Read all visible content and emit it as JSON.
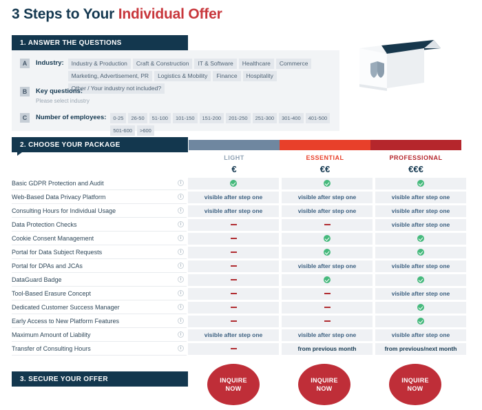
{
  "page_title": {
    "prefix": "3 Steps to Your ",
    "accent": "Individual Offer",
    "accent_color": "#c8373c",
    "base_color": "#143850"
  },
  "sections": {
    "step1_banner": "1. ANSWER THE QUESTIONS",
    "step2_banner": "2. CHOOSE YOUR PACKAGE",
    "step3_banner": "3. SECURE YOUR OFFER",
    "banner_color": "#13374e"
  },
  "step1": {
    "question_a": {
      "letter": "A",
      "label": "Industry:",
      "options": [
        "Industry & Production",
        "Craft & Construction",
        "IT & Software",
        "Healthcare",
        "Commerce",
        "Marketing, Advertisement, PR",
        "Logistics & Mobility",
        "Finance",
        "Hospitality",
        "Other / Your industry not included?"
      ]
    },
    "question_b": {
      "letter": "B",
      "label": "Key questions:",
      "note": "Please select industry"
    },
    "question_c": {
      "letter": "C",
      "label": "Number of employees:",
      "options": [
        "0-25",
        "26-50",
        "51-100",
        "101-150",
        "151-200",
        "201-250",
        "251-300",
        "301-400",
        "401-500",
        "501-600",
        ">600"
      ]
    }
  },
  "illustration": {
    "icon": "shield-in-box-icon",
    "description": "white 3d box with shield emblem"
  },
  "packages": [
    {
      "name": "LIGHT",
      "price": "€",
      "bar_color": "#6f87a0",
      "name_color": "#8fa1b3"
    },
    {
      "name": "ESSENTIAL",
      "price": "€€",
      "bar_color": "#e8402a",
      "name_color": "#e8402a"
    },
    {
      "name": "PROFESSIONAL",
      "price": "€€€",
      "bar_color": "#b5262c",
      "name_color": "#b5262c"
    }
  ],
  "features": [
    {
      "label": "Basic GDPR Protection and Audit",
      "light": "check",
      "essential": "check",
      "professional": "check"
    },
    {
      "label": "Web-Based Data Privacy Platform",
      "light": "visible after step one",
      "essential": "visible after step one",
      "professional": "visible after step one"
    },
    {
      "label": "Consulting Hours for Individual Usage",
      "light": "visible after step one",
      "essential": "visible after step one",
      "professional": "visible after step one"
    },
    {
      "label": "Data Protection Checks",
      "light": "dash",
      "essential": "dash",
      "professional": "visible after step one"
    },
    {
      "label": "Cookie Consent Management",
      "light": "dash",
      "essential": "check",
      "professional": "check"
    },
    {
      "label": "Portal for Data Subject Requests",
      "light": "dash",
      "essential": "check",
      "professional": "check"
    },
    {
      "label": "Portal for DPAs and JCAs",
      "light": "dash",
      "essential": "visible after step one",
      "professional": "visible after step one"
    },
    {
      "label": "DataGuard Badge",
      "light": "dash",
      "essential": "check",
      "professional": "check"
    },
    {
      "label": "Tool-Based Erasure Concept",
      "light": "dash",
      "essential": "dash",
      "professional": "visible after step one"
    },
    {
      "label": "Dedicated Customer Success Manager",
      "light": "dash",
      "essential": "dash",
      "professional": "check"
    },
    {
      "label": "Early Access to New Platform Features",
      "light": "dash",
      "essential": "dash",
      "professional": "check"
    },
    {
      "label": "Maximum Amount of Liability",
      "light": "visible after step one",
      "essential": "visible after step one",
      "professional": "visible after step one"
    },
    {
      "label": "Transfer of Consulting Hours",
      "light": "dash",
      "essential": "from previous month",
      "professional": "from previous/next month"
    }
  ],
  "cta": {
    "line1": "INQUIRE",
    "line2": "NOW",
    "color": "#bf2e38",
    "count": 3
  },
  "info_icon_name": "info-icon"
}
